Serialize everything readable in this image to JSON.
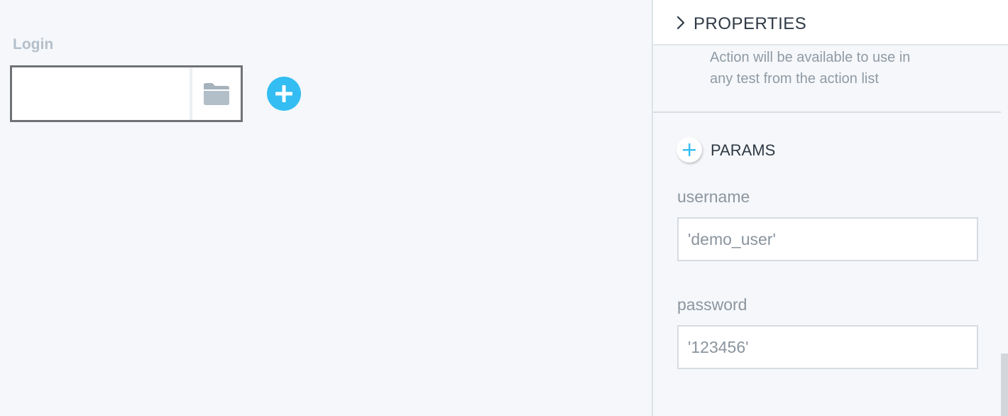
{
  "canvas": {
    "step_title": "Login",
    "step_input_value": "",
    "step_folder_icon": "folder-icon",
    "add_step_icon": "plus-icon"
  },
  "panel": {
    "header_title": "PROPERTIES",
    "header_icon": "chevron-right-icon",
    "description": "Action will be available to use in any test from the action list",
    "params_label": "PARAMS",
    "fields": [
      {
        "label": "username",
        "value": "'demo_user'"
      },
      {
        "label": "password",
        "value": "'123456'"
      }
    ]
  },
  "colors": {
    "accent": "#33bdf2",
    "text_dark": "#2f3a45",
    "text_muted": "#8f9aa4",
    "canvas_bg": "#f5f7fa"
  }
}
